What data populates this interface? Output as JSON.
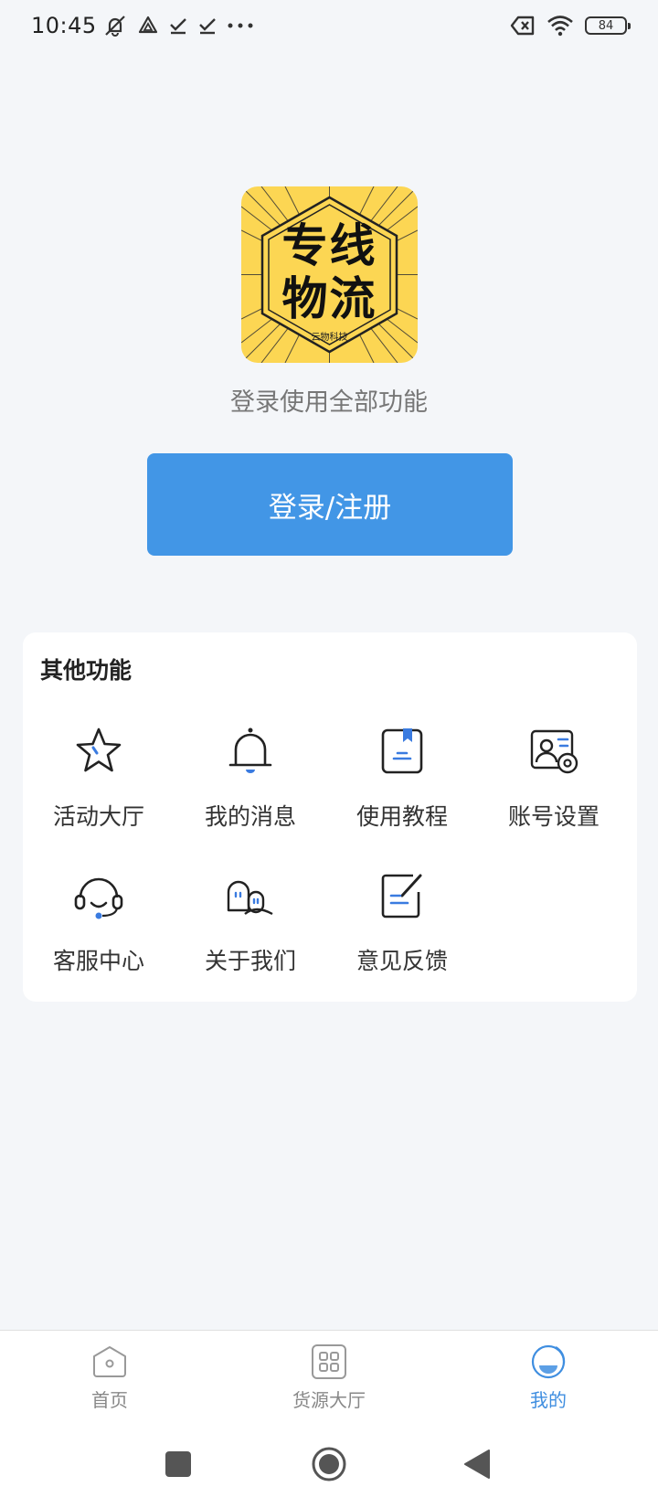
{
  "status_bar": {
    "time": "10:45",
    "battery": "84"
  },
  "logo": {
    "line1": "专线",
    "line2": "物流",
    "subtitle": "云物科技"
  },
  "login": {
    "hint": "登录使用全部功能",
    "button_label": "登录/注册"
  },
  "other_functions": {
    "title": "其他功能",
    "items": [
      {
        "label": "活动大厅",
        "icon": "star-icon"
      },
      {
        "label": "我的消息",
        "icon": "bell-icon"
      },
      {
        "label": "使用教程",
        "icon": "book-icon"
      },
      {
        "label": "账号设置",
        "icon": "account-settings-icon"
      },
      {
        "label": "客服中心",
        "icon": "headset-icon"
      },
      {
        "label": "关于我们",
        "icon": "people-icon"
      },
      {
        "label": "意见反馈",
        "icon": "feedback-icon"
      }
    ]
  },
  "bottom_nav": {
    "items": [
      {
        "label": "首页",
        "icon": "home-icon"
      },
      {
        "label": "货源大厅",
        "icon": "grid-icon"
      },
      {
        "label": "我的",
        "icon": "profile-icon",
        "active": true
      }
    ]
  },
  "colors": {
    "accent": "#4296e6",
    "active_tab": "#3f8ee0",
    "logo_bg": "#fcd653",
    "page_bg": "#f4f6f9"
  }
}
